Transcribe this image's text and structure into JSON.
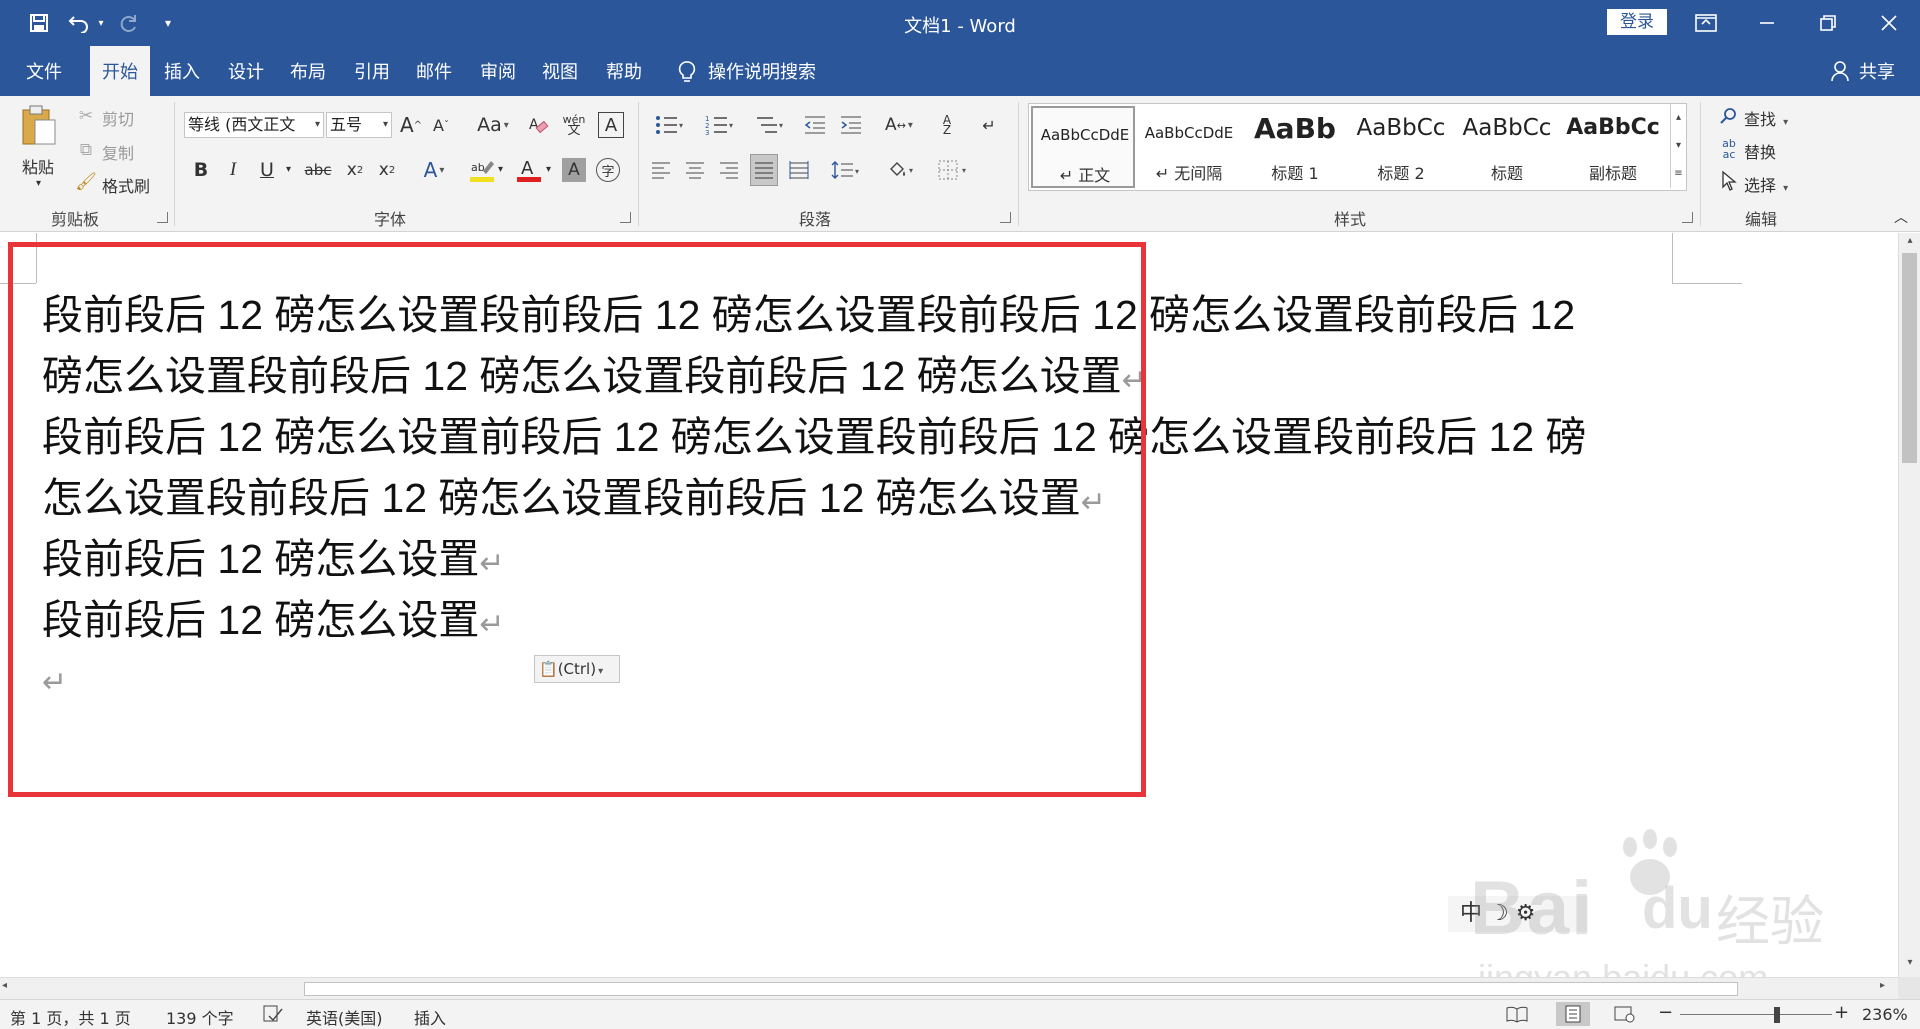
{
  "window": {
    "title": "文档1  -  Word",
    "login": "登录"
  },
  "tabs": [
    "文件",
    "开始",
    "插入",
    "设计",
    "布局",
    "引用",
    "邮件",
    "审阅",
    "视图",
    "帮助"
  ],
  "tell_me": "操作说明搜索",
  "share": "共享",
  "clipboard": {
    "paste": "粘贴",
    "cut": "剪切",
    "copy": "复制",
    "format_painter": "格式刷",
    "label": "剪贴板"
  },
  "font": {
    "font_name": "等线 (西文正文",
    "font_size": "五号",
    "label": "字体",
    "bold": "B",
    "italic": "I",
    "underline": "U",
    "strike": "abc",
    "aa": "Aa",
    "wen": "wén",
    "font_color_hex": "#e02020",
    "highlight_color_hex": "#f0e020"
  },
  "paragraph": {
    "label": "段落"
  },
  "styles": {
    "label": "样式",
    "items": [
      {
        "preview": "AaBbCcDdE",
        "name": "正文"
      },
      {
        "preview": "AaBbCcDdE",
        "name": "无间隔"
      },
      {
        "preview": "AaBb",
        "name": "标题 1"
      },
      {
        "preview": "AaBbCc",
        "name": "标题 2"
      },
      {
        "preview": "AaBbCc",
        "name": "标题"
      },
      {
        "preview": "AaBbCc",
        "name": "副标题"
      }
    ]
  },
  "editing": {
    "find": "查找",
    "replace": "替换",
    "select": "选择",
    "label": "编辑"
  },
  "document": {
    "lines": [
      "段前段后 12 磅怎么设置段前段后 12 磅怎么设置段前段后 12 磅怎么设置段前段后 12",
      "磅怎么设置段前段后 12 磅怎么设置段前段后 12 磅怎么设置",
      "段前段后 12 磅怎么设置前段后 12 磅怎么设置段前段后 12 磅怎么设置段前段后 12 磅",
      "怎么设置段前段后 12 磅怎么设置段前段后 12 磅怎么设置",
      "段前段后 12 磅怎么设置",
      "段前段后 12 磅怎么设置"
    ],
    "paste_options": "(Ctrl)",
    "highlight_color": "#e8353a"
  },
  "watermark": {
    "brand": "Bai",
    "brand2": "du",
    "jingyan": "经验",
    "url": "jingyan.baidu.com"
  },
  "status": {
    "page": "第 1 页，共 1 页",
    "words": "139 个字",
    "language": "英语(美国)",
    "mode": "插入",
    "zoom": "236%"
  },
  "colors": {
    "brand_blue": "#2b579a",
    "ribbon_bg": "#f3f3f3"
  }
}
